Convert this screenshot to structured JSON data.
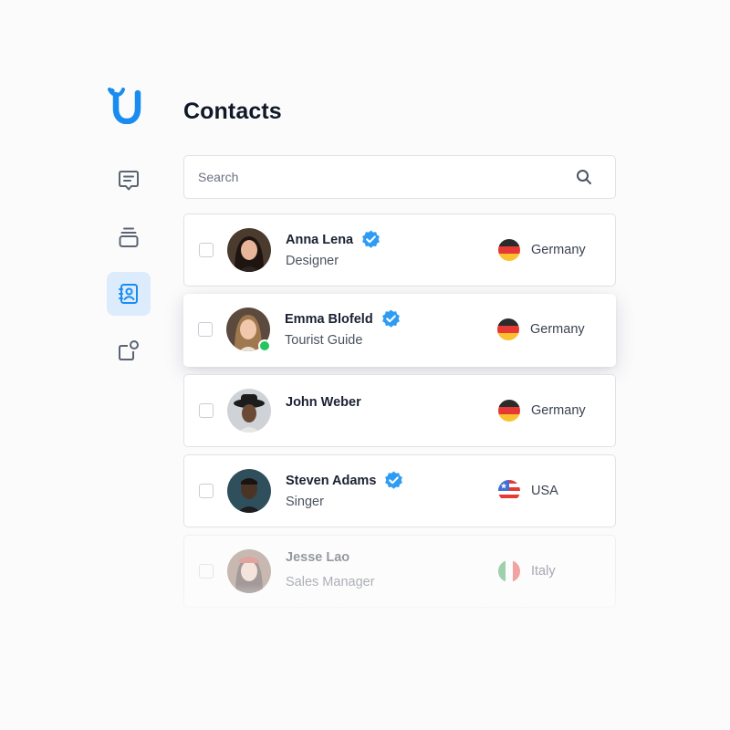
{
  "app": {
    "logo": "u-logo"
  },
  "sidebar": {
    "items": [
      {
        "icon": "chat-icon",
        "active": false
      },
      {
        "icon": "stack-icon",
        "active": false
      },
      {
        "icon": "contacts-book-icon",
        "active": true
      },
      {
        "icon": "shapes-icon",
        "active": false
      }
    ]
  },
  "page": {
    "title": "Contacts"
  },
  "search": {
    "placeholder": "Search",
    "value": ""
  },
  "colors": {
    "accent": "#1a8cf0",
    "nav_active_bg": "#dcecfd",
    "online": "#22c55e",
    "verified": "#2f9cf4"
  },
  "contacts": [
    {
      "name": "Anna Lena",
      "role": "Designer",
      "verified": true,
      "online": false,
      "country": "Germany",
      "flag": "germany-flag"
    },
    {
      "name": "Emma Blofeld",
      "role": "Tourist Guide",
      "verified": true,
      "online": true,
      "country": "Germany",
      "flag": "germany-flag"
    },
    {
      "name": "John Weber",
      "role": "",
      "verified": false,
      "online": false,
      "country": "Germany",
      "flag": "germany-flag"
    },
    {
      "name": "Steven Adams",
      "role": "Singer",
      "verified": true,
      "online": false,
      "country": "USA",
      "flag": "usa-flag"
    },
    {
      "name": "Jesse Lao",
      "role": "Sales Manager",
      "verified": false,
      "online": false,
      "country": "Italy",
      "flag": "italy-flag"
    }
  ]
}
